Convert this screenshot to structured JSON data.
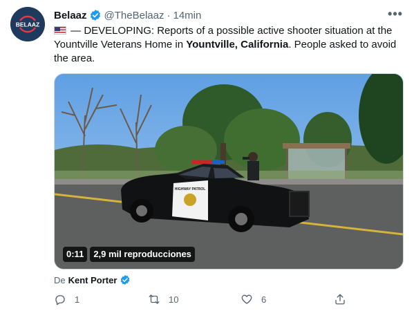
{
  "tweet": {
    "avatar_text": "BELAAZ",
    "display_name": "Belaaz",
    "handle": "@TheBelaaz",
    "separator": "·",
    "timestamp": "14min",
    "text_parts": {
      "p1": "— DEVELOPING: Reports of a possible active shooter situation at the Yountville Veterans Home in ",
      "bold": "Yountville, California",
      "p2": ". People asked to avoid the area."
    },
    "video": {
      "duration": "0:11",
      "views": "2,9 mil reproducciones",
      "car_badge": "HIGHWAY PATROL"
    },
    "byline": {
      "prefix": "De",
      "author": "Kent Porter"
    },
    "actions": {
      "replies": "1",
      "retweets": "10",
      "likes": "6"
    }
  },
  "colors": {
    "verified": "#1d9bf0",
    "muted": "#536471",
    "text": "#0f1419",
    "avatar_bg": "#1e3a5f",
    "avatar_accent": "#e63946"
  },
  "icons": {
    "more": "more-icon",
    "reply": "reply-icon",
    "retweet": "retweet-icon",
    "like": "heart-icon",
    "share": "share-icon",
    "verified": "verified-badge-icon",
    "flag": "us-flag-icon"
  }
}
